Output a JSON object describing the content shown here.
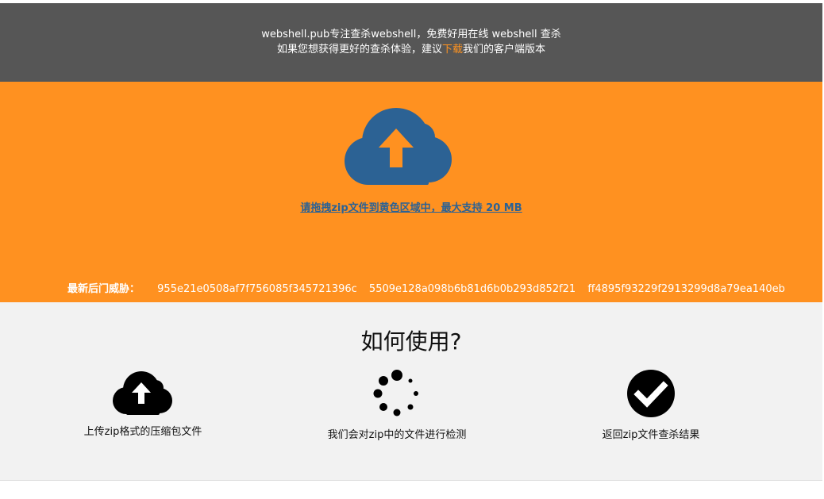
{
  "colors": {
    "topbar_bg": "#565656",
    "dropzone_bg": "#ff9120",
    "accent_link": "#ff9320",
    "upload_icon": "#2c6294",
    "howto_bg": "#f2f2f2"
  },
  "header": {
    "line1": "webshell.pub专注查杀webshell，免费好用在线 webshell 查杀",
    "line2_before": "如果您想获得更好的查杀体验，建议",
    "line2_link": "下载",
    "line2_after": "我们的客户端版本"
  },
  "dropzone": {
    "icon": "cloud-upload-icon",
    "hint": "请拖拽zip文件到黄色区域中，最大支持 20 MB",
    "threats_label": "最新后门威胁：",
    "threats": [
      "955e21e0508af7f756085f345721396c",
      "5509e128a098b6b81d6b0b293d852f21",
      "ff4895f93229f2913299d8a79ea140eb"
    ]
  },
  "howto": {
    "title": "如何使用?",
    "steps": [
      {
        "icon": "cloud-upload-icon",
        "label": "上传zip格式的压缩包文件"
      },
      {
        "icon": "spinner-icon",
        "label": "我们会对zip中的文件进行检测"
      },
      {
        "icon": "check-circle-icon",
        "label": "返回zip文件查杀结果"
      }
    ]
  }
}
